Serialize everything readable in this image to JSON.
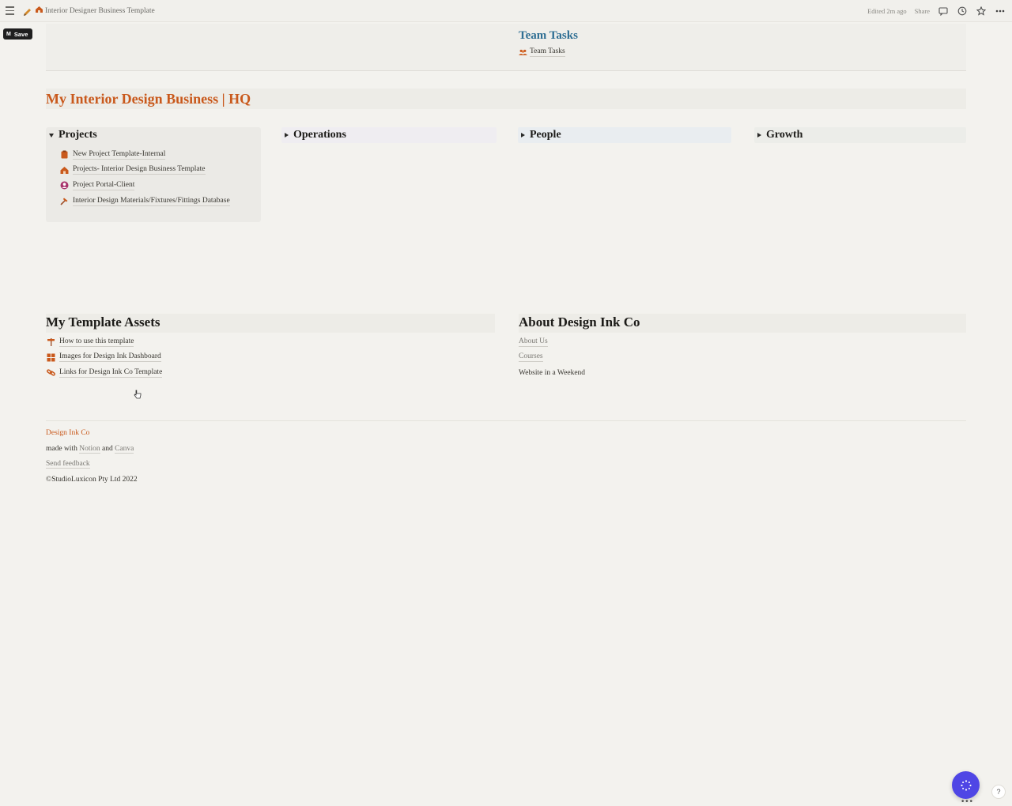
{
  "topbar": {
    "page_title": "Interior Designer Business Template",
    "edited": "Edited 2m ago",
    "share": "Share"
  },
  "save_button": {
    "logo": "M",
    "label": "Save"
  },
  "team_tasks": {
    "heading": "Team Tasks",
    "link_label": "Team Tasks",
    "icon": "people-icon"
  },
  "hq_title": "My Interior Design Business | HQ",
  "toggles": [
    {
      "label": "Projects",
      "open": true
    },
    {
      "label": "Operations",
      "open": false
    },
    {
      "label": "People",
      "open": false
    },
    {
      "label": "Growth",
      "open": false
    }
  ],
  "projects_items": [
    {
      "label": "New Project Template-Internal",
      "icon": "clipboard-icon"
    },
    {
      "label": "Projects- Interior Design Business Template",
      "icon": "house-icon"
    },
    {
      "label": "Project Portal-Client",
      "icon": "user-circle-icon"
    },
    {
      "label": "Interior Design Materials/Fixtures/Fittings Database",
      "icon": "hammer-icon"
    }
  ],
  "assets": {
    "title": "My Template Assets",
    "items": [
      {
        "label": "How to use this template",
        "icon": "signpost-icon"
      },
      {
        "label": "Images for Design Ink Dashboard",
        "icon": "grid-icon"
      },
      {
        "label": "Links for Design Ink Co Template",
        "icon": "link-icon"
      }
    ]
  },
  "about": {
    "title": "About Design Ink Co",
    "items": [
      {
        "label": "About Us"
      },
      {
        "label": "Courses"
      },
      {
        "label": "Website in a Weekend"
      }
    ]
  },
  "footer": {
    "brand": "Design Ink Co",
    "made_with_prefix": "made with",
    "notion": "Notion",
    "and": "and",
    "canva": "Canva",
    "feedback": "Send feedback",
    "copyright": "©StudioLuxicon Pty Ltd 2022"
  },
  "colors": {
    "accent_orange": "#c9591c",
    "team_blue": "#2e6e93",
    "fab_purple": "#4f46e5"
  },
  "help_label": "?"
}
